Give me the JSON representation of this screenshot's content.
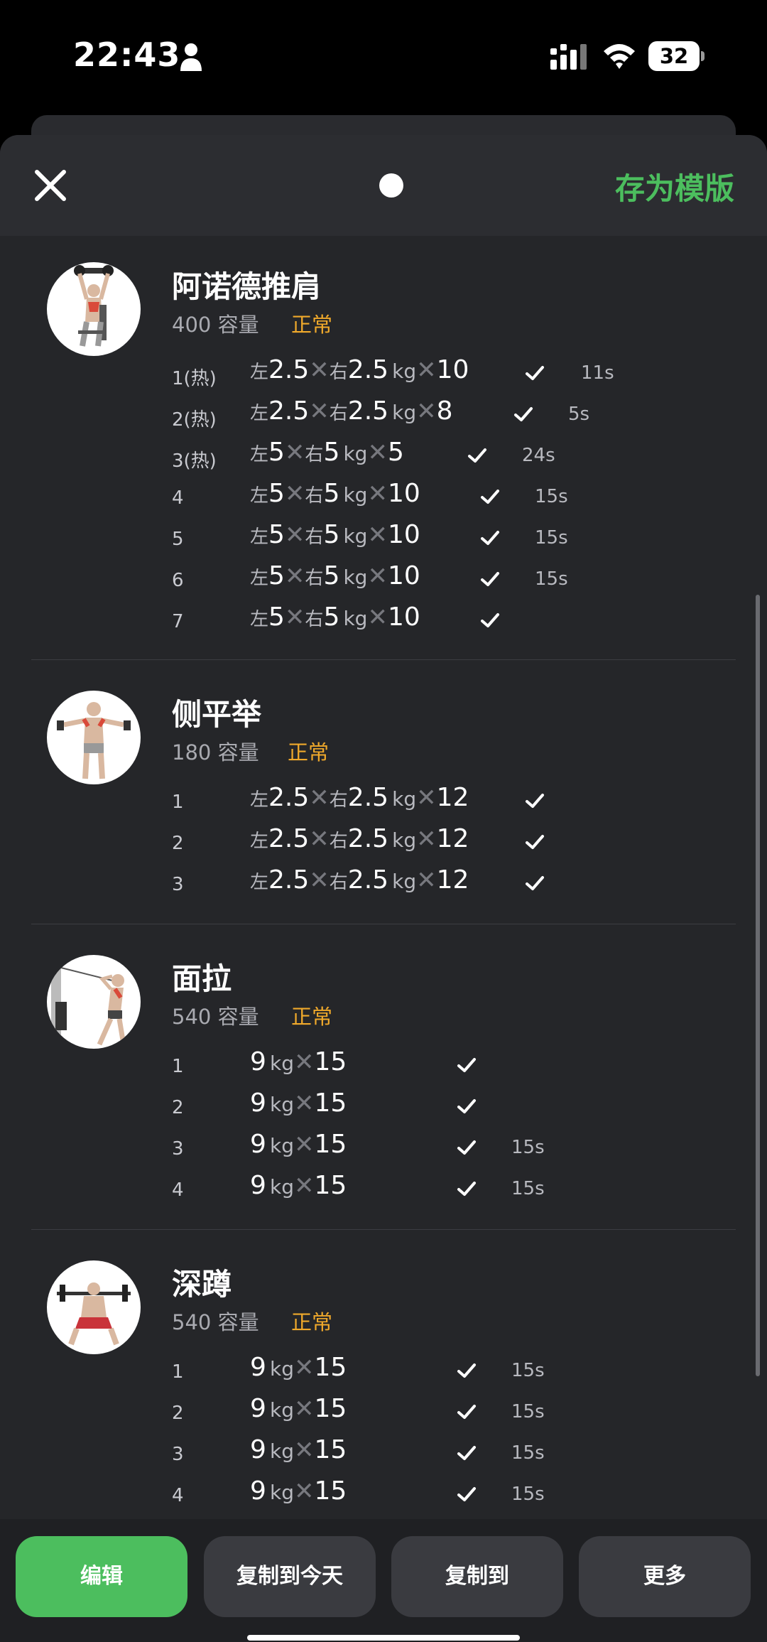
{
  "status_bar": {
    "time": "22:43",
    "battery": "32"
  },
  "header": {
    "save_template": "存为模版"
  },
  "exercises": [
    {
      "name": "阿诺德推肩",
      "volume": "400 容量",
      "status": "正常",
      "sets": [
        {
          "idx": "1(热)",
          "left": "2.5",
          "right": "2.5",
          "reps": "10",
          "rest": "11s"
        },
        {
          "idx": "2(热)",
          "left": "2.5",
          "right": "2.5",
          "reps": "8",
          "rest": "5s"
        },
        {
          "idx": "3(热)",
          "left": "5",
          "right": "5",
          "reps": "5",
          "rest": "24s"
        },
        {
          "idx": "4",
          "left": "5",
          "right": "5",
          "reps": "10",
          "rest": "15s"
        },
        {
          "idx": "5",
          "left": "5",
          "right": "5",
          "reps": "10",
          "rest": "15s"
        },
        {
          "idx": "6",
          "left": "5",
          "right": "5",
          "reps": "10",
          "rest": "15s"
        },
        {
          "idx": "7",
          "left": "5",
          "right": "5",
          "reps": "10",
          "rest": ""
        }
      ]
    },
    {
      "name": "侧平举",
      "volume": "180 容量",
      "status": "正常",
      "sets": [
        {
          "idx": "1",
          "left": "2.5",
          "right": "2.5",
          "reps": "12",
          "rest": ""
        },
        {
          "idx": "2",
          "left": "2.5",
          "right": "2.5",
          "reps": "12",
          "rest": ""
        },
        {
          "idx": "3",
          "left": "2.5",
          "right": "2.5",
          "reps": "12",
          "rest": ""
        }
      ]
    },
    {
      "name": "面拉",
      "volume": "540 容量",
      "status": "正常",
      "sets": [
        {
          "idx": "1",
          "weight": "9",
          "reps": "15",
          "rest": ""
        },
        {
          "idx": "2",
          "weight": "9",
          "reps": "15",
          "rest": ""
        },
        {
          "idx": "3",
          "weight": "9",
          "reps": "15",
          "rest": "15s"
        },
        {
          "idx": "4",
          "weight": "9",
          "reps": "15",
          "rest": "15s"
        }
      ]
    },
    {
      "name": "深蹲",
      "volume": "540 容量",
      "status": "正常",
      "sets": [
        {
          "idx": "1",
          "weight": "9",
          "reps": "15",
          "rest": "15s"
        },
        {
          "idx": "2",
          "weight": "9",
          "reps": "15",
          "rest": "15s"
        },
        {
          "idx": "3",
          "weight": "9",
          "reps": "15",
          "rest": "15s"
        },
        {
          "idx": "4",
          "weight": "9",
          "reps": "15",
          "rest": "15s"
        }
      ]
    }
  ],
  "labels": {
    "left": "左",
    "right": "右",
    "times": "✕",
    "kg": "kg"
  },
  "bottom_bar": {
    "edit": "编辑",
    "copy_today": "复制到今天",
    "copy_to": "复制到",
    "more": "更多"
  },
  "colors": {
    "accent_green": "#4cbe5e",
    "status_orange": "#f0a92b",
    "sheet_bg": "#252629"
  }
}
